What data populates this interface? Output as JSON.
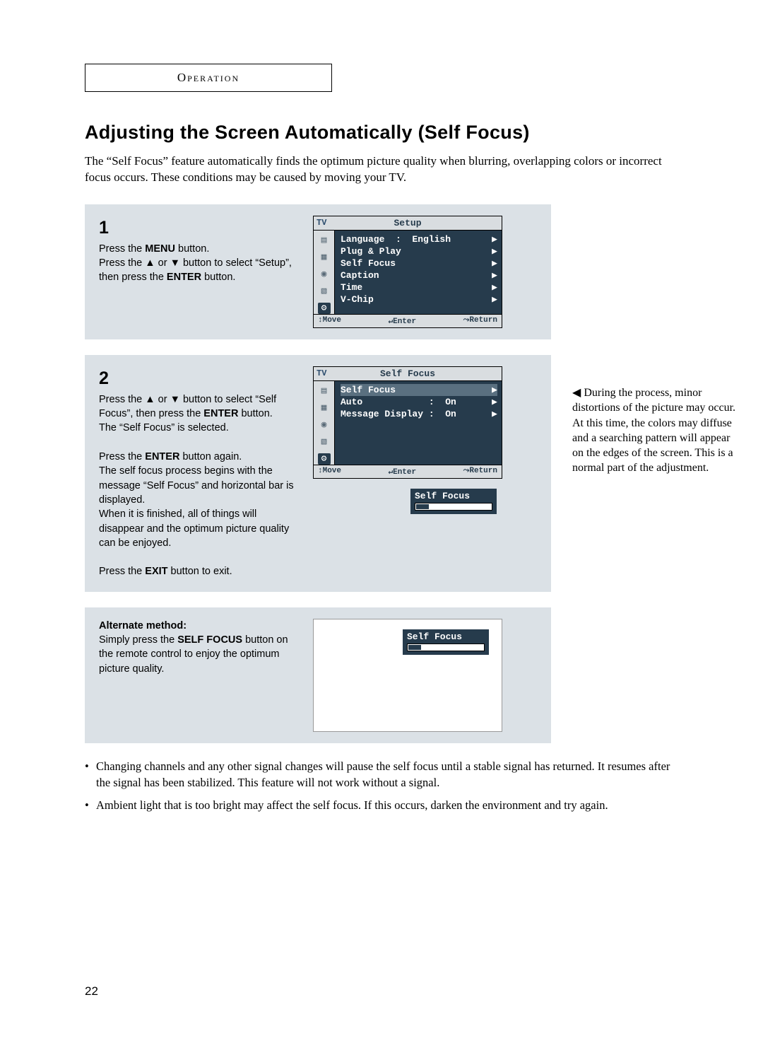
{
  "section_label": "Operation",
  "title": "Adjusting the Screen Automatically (Self Focus)",
  "intro": "The “Self Focus” feature automatically finds the optimum picture quality when blurring, overlapping colors or incorrect focus occurs. These conditions may be caused by moving your TV.",
  "step1": {
    "num": "1",
    "text_before_menu": "Press the ",
    "menu_word": "MENU",
    "text_after_menu": " button.",
    "line2a": "Press the ",
    "up": "▲",
    "line2b": " or ",
    "down": "▼",
    "line2c": " button to select “Setup”, then press the ",
    "enter_word": "ENTER",
    "line2d": " button."
  },
  "step2": {
    "num": "2",
    "line1a": "Press the ",
    "up": "▲",
    "line1b": " or ",
    "down": "▼",
    "line1c": " button to select “Self Focus”, then press the ",
    "enter_word": "ENTER",
    "line1d": " button.",
    "line2": "The “Self Focus” is selected.",
    "para2a": "Press the ",
    "enter2": "ENTER",
    "para2b": " button again.",
    "para2c": "The self focus process begins with the message “Self Focus” and horizontal bar is displayed.",
    "para2d": "When it is finished, all of things will disappear and the optimum picture quality can be enjoyed.",
    "exit_a": "Press the ",
    "exit_word": "EXIT",
    "exit_b": " button to exit."
  },
  "step3": {
    "heading": "Alternate method:",
    "text_a": "Simply press the ",
    "sf_word": "SELF FOCUS",
    "text_b": " button on the remote control to enjoy the optimum picture quality."
  },
  "side_note_arrow": "◀",
  "side_note": " During the process, minor distortions of the picture may occur. At this time, the colors may diffuse and a searching pattern will appear on the edges of the screen. This is a normal part of the adjustment.",
  "osd1": {
    "tv": "TV",
    "title": "Setup",
    "items": [
      {
        "label": "Language  :  English",
        "arrow": "▶"
      },
      {
        "label": "Plug & Play",
        "arrow": "▶"
      },
      {
        "label": "Self Focus",
        "arrow": "▶"
      },
      {
        "label": "Caption",
        "arrow": "▶"
      },
      {
        "label": "Time",
        "arrow": "▶"
      },
      {
        "label": "V-Chip",
        "arrow": "▶"
      }
    ],
    "footer_move": "↕Move",
    "footer_enter": "↵Enter",
    "footer_return": "⤳Return"
  },
  "osd2": {
    "tv": "TV",
    "title": "Self Focus",
    "items": [
      {
        "label": "Self Focus",
        "arrow": "▶",
        "hl": true
      },
      {
        "label": "Auto            :  On",
        "arrow": "▶"
      },
      {
        "label": "Message Display :  On",
        "arrow": "▶"
      }
    ],
    "footer_move": "↕Move",
    "footer_enter": "↵Enter",
    "footer_return": "⤳Return"
  },
  "progress_label": "Self Focus",
  "bullets": [
    "Changing channels and any other signal changes will pause the self focus until a stable signal has returned. It resumes after the signal has been stabilized. This feature will not work without a signal.",
    "Ambient light that is too bright may affect the self focus. If this occurs, darken the environment and try again."
  ],
  "page_number": "22",
  "icons": [
    "▤",
    "▦",
    "◉",
    "▧",
    "⚙"
  ]
}
